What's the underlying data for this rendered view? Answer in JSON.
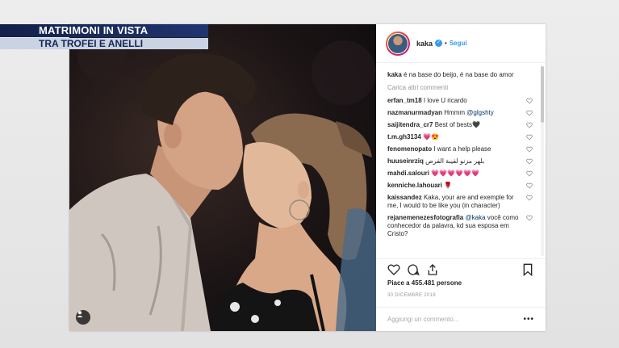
{
  "banner": {
    "line1": "MATRIMONI IN VISTA",
    "line2": "TRA TROFEI E ANELLI"
  },
  "post": {
    "username": "kaka",
    "separator": "•",
    "follow_label": "Segui",
    "caption": {
      "user": "kaka",
      "text": "é na base do beijo, é na base do amor"
    },
    "load_more": "Carica altri commenti",
    "comments": [
      {
        "user": "erfan_tm18",
        "text": "I love U ricardo"
      },
      {
        "user": "nazmanurmadyan",
        "text": "Hmmm ",
        "mention": "@glgshty"
      },
      {
        "user": "saijitendra_cr7",
        "text": "Best of bests🖤"
      },
      {
        "user": "t.m.gh3134",
        "text": "💗😍"
      },
      {
        "user": "fenomenopato",
        "text": "I want a help please"
      },
      {
        "user": "huuseinrziq",
        "text": "بلهر مزنو لفيبة الفرص"
      },
      {
        "user": "mahdi.salouri",
        "text": "💗💗💗💗💗💗"
      },
      {
        "user": "kenniche.lahouari",
        "text": "🌹"
      },
      {
        "user": "kaissandez",
        "text": "Kaka, your are and exemple for me, I would to be like you (in character)"
      },
      {
        "user": "rejanemenezesfotografia",
        "text": " você como conhecedor da palavra, kd sua esposa em Cristo?",
        "mention": "@kaka"
      }
    ],
    "likes": "Piace a 455.481 persone",
    "date": "30 DICEMBRE 2018",
    "add_comment_placeholder": "Aggiungi un commento...",
    "more_label": "•••"
  },
  "icons": {
    "verified": "verified-badge-icon",
    "heart": "heart-icon",
    "comment": "comment-icon",
    "share": "share-icon",
    "bookmark": "bookmark-icon",
    "user_tag": "user-tag-icon"
  },
  "colors": {
    "banner_dark": "#13204a",
    "banner_light": "#c9d3e3",
    "link_blue": "#3897f0"
  }
}
